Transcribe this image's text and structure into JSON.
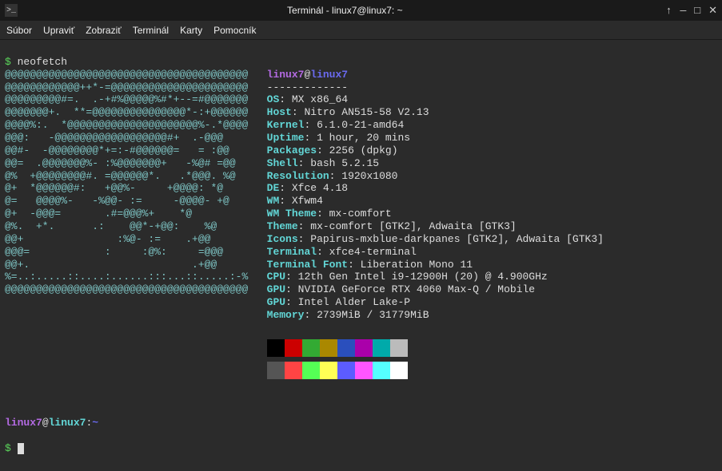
{
  "window": {
    "title": "Terminál - linux7@linux7: ~",
    "icon": ">_",
    "buttons": {
      "up": "↑",
      "min": "—",
      "max": "□",
      "close": "✕"
    }
  },
  "menubar": [
    "Súbor",
    "Upraviť",
    "Zobraziť",
    "Terminál",
    "Karty",
    "Pomocník"
  ],
  "prompt_symbol": "$",
  "command": "neofetch",
  "ascii": [
    "@@@@@@@@@@@@@@@@@@@@@@@@@@@@@@@@@@@@@@@",
    "@@@@@@@@@@@@++*-=@@@@@@@@@@@@@@@@@@@@@@",
    "@@@@@@@@@#=.  .-+#%@@@@@%#*+--=#@@@@@@@",
    "@@@@@@@+.  **=@@@@@@@@@@@@@@@*-:+@@@@@@",
    "@@@@%:.  *@@@@@@@@@@@@@@@@@@@@@%-.*@@@@",
    "@@@:   -@@@@@@@@@@@@@@@@@@#+  .-@@@",
    "@@#-  -@@@@@@@@*+=:-#@@@@@@=   = :@@",
    "@@=  .@@@@@@@%- :%@@@@@@@+   -%@# =@@",
    "@%  +@@@@@@@@#. =@@@@@@*.   .*@@@. %@",
    "@+  *@@@@@@#:   +@@%-     +@@@@: *@",
    "@=   @@@@%-   -%@@- :=     -@@@@- +@",
    "@+  -@@@=       .#=@@@%+    *@",
    "@%.  +*.      .:    @@*-+@@:    %@",
    "@@+               :%@- :=    .+@@",
    "@@@=            :     :@%:     =@@@",
    "@@+.                          .+@@",
    "%=..:.....::....:......:::...::.....:-%",
    "@@@@@@@@@@@@@@@@@@@@@@@@@@@@@@@@@@@@@@@"
  ],
  "header": {
    "user": "linux7",
    "at": "@",
    "host": "linux7"
  },
  "dashes": "-------------",
  "info": [
    {
      "k": "OS",
      "v": "MX x86_64"
    },
    {
      "k": "Host",
      "v": "Nitro AN515-58 V2.13"
    },
    {
      "k": "Kernel",
      "v": "6.1.0-21-amd64"
    },
    {
      "k": "Uptime",
      "v": "1 hour, 20 mins"
    },
    {
      "k": "Packages",
      "v": "2256 (dpkg)"
    },
    {
      "k": "Shell",
      "v": "bash 5.2.15"
    },
    {
      "k": "Resolution",
      "v": "1920x1080"
    },
    {
      "k": "DE",
      "v": "Xfce 4.18"
    },
    {
      "k": "WM",
      "v": "Xfwm4"
    },
    {
      "k": "WM Theme",
      "v": "mx-comfort"
    },
    {
      "k": "Theme",
      "v": "mx-comfort [GTK2], Adwaita [GTK3]"
    },
    {
      "k": "Icons",
      "v": "Papirus-mxblue-darkpanes [GTK2], Adwaita [GTK3]"
    },
    {
      "k": "Terminal",
      "v": "xfce4-terminal"
    },
    {
      "k": "Terminal Font",
      "v": "Liberation Mono 11"
    },
    {
      "k": "CPU",
      "v": "12th Gen Intel i9-12900H (20) @ 4.900GHz"
    },
    {
      "k": "GPU",
      "v": "NVIDIA GeForce RTX 4060 Max-Q / Mobile"
    },
    {
      "k": "GPU",
      "v": "Intel Alder Lake-P"
    },
    {
      "k": "Memory",
      "v": "2739MiB / 31779MiB"
    }
  ],
  "swatches_row1": [
    "#000000",
    "#cc0000",
    "#33aa33",
    "#aa8800",
    "#2a4fbd",
    "#aa00aa",
    "#00aaaa",
    "#bbbbbb"
  ],
  "swatches_row2": [
    "#555555",
    "#ff4444",
    "#55ff55",
    "#ffff55",
    "#5c5cff",
    "#ff55ff",
    "#55ffff",
    "#ffffff"
  ],
  "bottom_prompt": {
    "user": "linux7",
    "host": "linux7",
    "path": "~"
  }
}
